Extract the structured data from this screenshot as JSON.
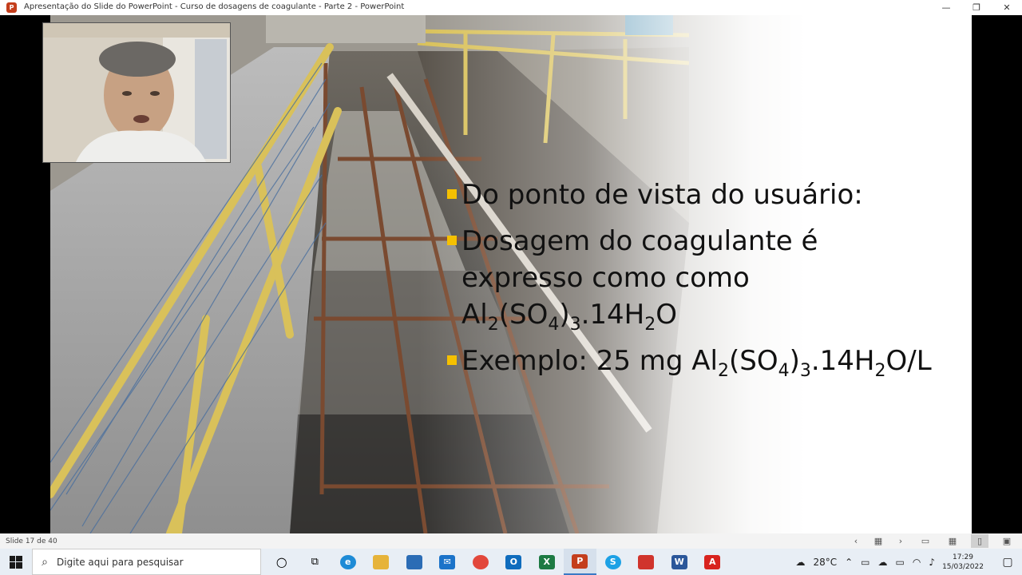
{
  "window": {
    "title": "Apresentação do Slide do PowerPoint - Curso de dosagens de coagulante - Parte 2 - PowerPoint",
    "app_icon": "P",
    "minimize": "—",
    "maximize": "❐",
    "close": "✕"
  },
  "slide": {
    "bullets": [
      {
        "text": "Do ponto de vista do usuário:"
      },
      {
        "line1": "Dosagem do coagulante é",
        "line2": "expresso como como",
        "f_a": "Al",
        "f_s1": "2",
        "f_b": "(SO",
        "f_s2": "4",
        "f_c": ")",
        "f_s3": "3",
        "f_d": ".14H",
        "f_s4": "2",
        "f_e": "O"
      },
      {
        "a": "Exemplo: 25 mg Al",
        "s1": "2",
        "b": "(SO",
        "s2": "4",
        "c": ")",
        "s3": "3",
        "d": ".14H",
        "s4": "2",
        "e": "O/L"
      }
    ]
  },
  "statusbar": {
    "slide_counter": "Slide 17 de 40",
    "prev": "‹",
    "next": "›"
  },
  "taskbar": {
    "search_placeholder": "Digite aqui para pesquisar",
    "temperature": "28°C",
    "time": "17:29",
    "date": "15/03/2022"
  },
  "colors": {
    "bullet_marker": "#f5c000",
    "powerpoint_red": "#c43e1c"
  }
}
